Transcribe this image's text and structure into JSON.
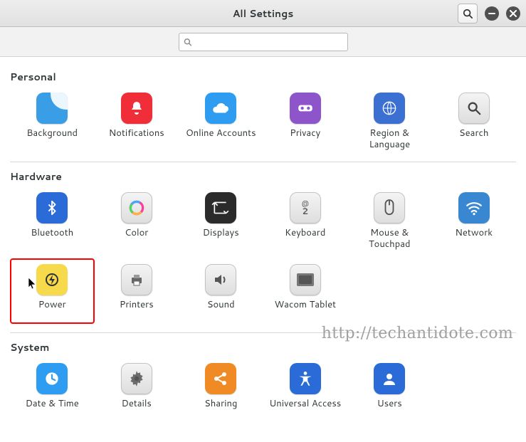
{
  "window": {
    "title": "All Settings"
  },
  "search": {
    "value": "",
    "placeholder": ""
  },
  "sections": {
    "personal": {
      "title": "Personal",
      "items": [
        {
          "name": "background",
          "label": "Background"
        },
        {
          "name": "notifications",
          "label": "Notifications"
        },
        {
          "name": "online-accounts",
          "label": "Online Accounts"
        },
        {
          "name": "privacy",
          "label": "Privacy"
        },
        {
          "name": "region-language",
          "label": "Region & Language"
        },
        {
          "name": "search",
          "label": "Search"
        }
      ]
    },
    "hardware": {
      "title": "Hardware",
      "items": [
        {
          "name": "bluetooth",
          "label": "Bluetooth"
        },
        {
          "name": "color",
          "label": "Color"
        },
        {
          "name": "displays",
          "label": "Displays"
        },
        {
          "name": "keyboard",
          "label": "Keyboard"
        },
        {
          "name": "mouse-touchpad",
          "label": "Mouse & Touchpad"
        },
        {
          "name": "network",
          "label": "Network"
        },
        {
          "name": "power",
          "label": "Power",
          "highlight": true
        },
        {
          "name": "printers",
          "label": "Printers"
        },
        {
          "name": "sound",
          "label": "Sound"
        },
        {
          "name": "wacom-tablet",
          "label": "Wacom Tablet"
        }
      ]
    },
    "system": {
      "title": "System",
      "items": [
        {
          "name": "date-time",
          "label": "Date & Time"
        },
        {
          "name": "details",
          "label": "Details"
        },
        {
          "name": "sharing",
          "label": "Sharing"
        },
        {
          "name": "universal-access",
          "label": "Universal Access"
        },
        {
          "name": "users",
          "label": "Users"
        }
      ]
    }
  },
  "watermark": "http://techantidote.com"
}
